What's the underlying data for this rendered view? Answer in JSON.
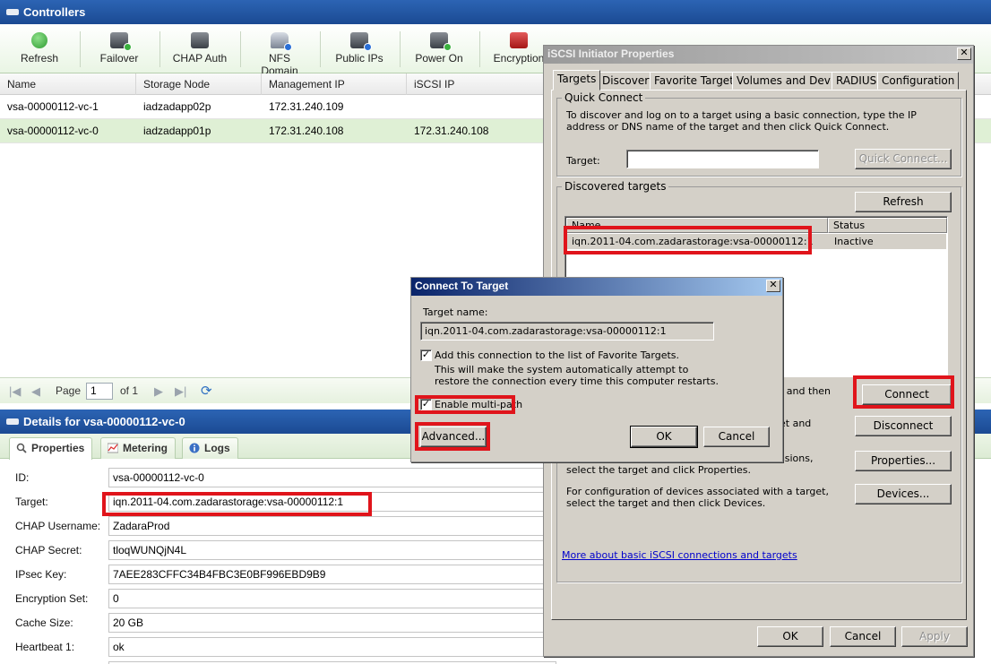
{
  "controllers": {
    "title": "Controllers",
    "toolbar": [
      {
        "label": "Refresh",
        "icon": "refresh-icon"
      },
      {
        "label": "Failover",
        "icon": "failover-icon"
      },
      {
        "label": "CHAP Auth",
        "icon": "chap-auth-icon"
      },
      {
        "label": "NFS Domain",
        "icon": "nfs-domain-icon"
      },
      {
        "label": "Public IPs",
        "icon": "public-ips-icon"
      },
      {
        "label": "Power On",
        "icon": "power-on-icon"
      },
      {
        "label": "Encryption",
        "icon": "encryption-icon"
      }
    ],
    "columns": [
      "Name",
      "Storage Node",
      "Management IP",
      "iSCSI IP"
    ],
    "rows": [
      {
        "name": "vsa-00000112-vc-1",
        "storage_node": "iadzadapp02p",
        "management_ip": "172.31.240.109",
        "iscsi_ip": ""
      },
      {
        "name": "vsa-00000112-vc-0",
        "storage_node": "iadzadapp01p",
        "management_ip": "172.31.240.108",
        "iscsi_ip": "172.31.240.108"
      }
    ],
    "pager": {
      "page_label": "Page",
      "page_value": "1",
      "of_label": "of 1"
    }
  },
  "details": {
    "title": "Details for vsa-00000112-vc-0",
    "tabs": [
      "Properties",
      "Metering",
      "Logs"
    ],
    "properties": [
      {
        "label": "ID:",
        "value": "vsa-00000112-vc-0"
      },
      {
        "label": "Target:",
        "value": "iqn.2011-04.com.zadarastorage:vsa-00000112:1"
      },
      {
        "label": "CHAP Username:",
        "value": "ZadaraProd"
      },
      {
        "label": "CHAP Secret:",
        "value": "tloqWUNQjN4L"
      },
      {
        "label": "IPsec Key:",
        "value": "7AEE283CFFC34B4FBC3E0BF996EBD9B9"
      },
      {
        "label": "Encryption Set:",
        "value": "0"
      },
      {
        "label": "Cache Size:",
        "value": "20 GB"
      },
      {
        "label": "Heartbeat 1:",
        "value": "ok"
      }
    ]
  },
  "iscsi": {
    "title": "iSCSI Initiator Properties",
    "tabs": [
      "Targets",
      "Discovery",
      "Favorite Targets",
      "Volumes and Devices",
      "RADIUS",
      "Configuration"
    ],
    "quick_connect": {
      "legend": "Quick Connect",
      "description": "To discover and log on to a target using a basic connection, type the IP address or DNS name of the target and then click Quick Connect.",
      "target_label": "Target:",
      "target_value": "",
      "button": "Quick Connect..."
    },
    "discovered": {
      "legend": "Discovered targets",
      "refresh_button": "Refresh",
      "columns": [
        "Name",
        "Status"
      ],
      "rows": [
        {
          "name": "iqn.2011-04.com.zadarastorage:vsa-00000112:1",
          "status": "Inactive"
        }
      ]
    },
    "connect_fragment": "t and then",
    "connect_button": "Connect",
    "disconnect_fragment": "et and",
    "disconnect_button": "Disconnect",
    "properties_fragment": "ssions,",
    "properties_text": "select the target and click Properties.",
    "properties_button": "Properties...",
    "devices_text": "For configuration of devices associated with a target, select the target and then click Devices.",
    "devices_button": "Devices...",
    "more_link": "More about basic iSCSI connections and targets",
    "ok": "OK",
    "cancel": "Cancel",
    "apply": "Apply"
  },
  "connect_dialog": {
    "title": "Connect To Target",
    "target_name_label": "Target name:",
    "target_name_value": "iqn.2011-04.com.zadarastorage:vsa-00000112:1",
    "favorite_label": "Add this connection to the list of Favorite Targets.",
    "favorite_note": "This will make the system automatically attempt to restore the connection every time this computer restarts.",
    "multipath_label": "Enable multi-path",
    "advanced": "Advanced...",
    "ok": "OK",
    "cancel": "Cancel"
  }
}
